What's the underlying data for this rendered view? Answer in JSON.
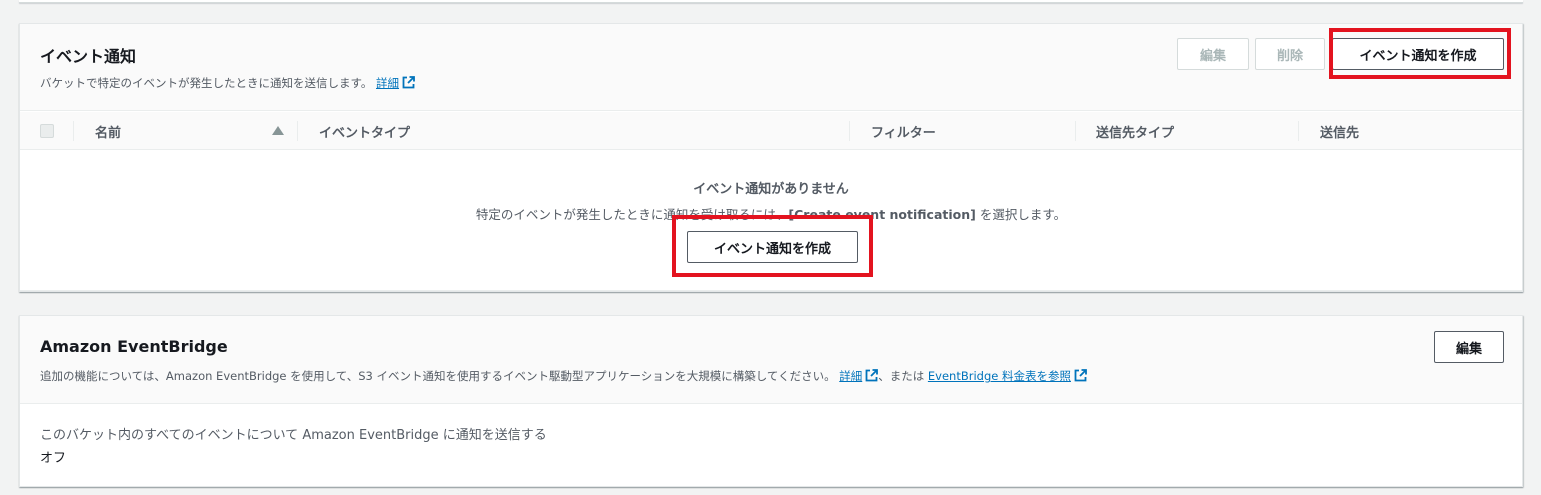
{
  "events_panel": {
    "title": "イベント通知",
    "description": "バケットで特定のイベントが発生したときに通知を送信します。",
    "details_link": "詳細",
    "buttons": {
      "edit": "編集",
      "delete": "削除",
      "create": "イベント通知を作成"
    },
    "table": {
      "columns": [
        "名前",
        "イベントタイプ",
        "フィルター",
        "送信先タイプ",
        "送信先"
      ]
    },
    "empty_state": {
      "title": "イベント通知がありません",
      "desc_prefix": "特定のイベントが発生したときに通知を受け取るには、",
      "desc_bold": "[Create event notification]",
      "desc_suffix": " を選択します。",
      "button": "イベント通知を作成"
    }
  },
  "eventbridge_panel": {
    "title": "Amazon EventBridge",
    "description": "追加の機能については、Amazon EventBridge を使用して、S3 イベント通知を使用するイベント駆動型アプリケーションを大規模に構築してください。",
    "details_link": "詳細",
    "separator": "、または",
    "pricing_link": "EventBridge 料金表を参照",
    "edit_button": "編集",
    "setting_label": "このバケット内のすべてのイベントについて Amazon EventBridge に通知を送信する",
    "setting_value": "オフ"
  },
  "colors": {
    "link": "#0073bb",
    "highlight": "#e3131f"
  }
}
